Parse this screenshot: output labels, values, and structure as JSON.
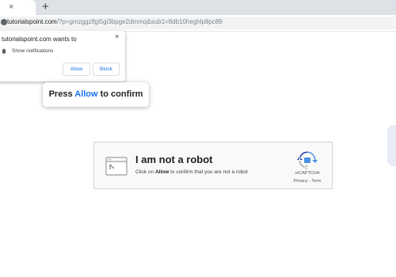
{
  "browser": {
    "new_tab_symbol": "+",
    "tab_close_symbol": "×",
    "url_host": "tutorialspoint.com",
    "url_path": "/?p=gmzggzlfgi5gi3bpge2dmmq&sub1=8db10heghlp8pc89"
  },
  "notification_prompt": {
    "title": "tutorialspoint.com wants to",
    "close_symbol": "×",
    "permission_label": "Show notifications",
    "allow_label": "Allow",
    "block_label": "Block"
  },
  "callout": {
    "prefix": "Press ",
    "highlight": "Allow",
    "suffix": " to confirm",
    "highlight_color": "#1a73e8"
  },
  "captcha": {
    "title": "I am not a robot",
    "sub_prefix": "Click on ",
    "sub_bold": "Allow",
    "sub_suffix": " to confirm that you are not a robot",
    "brand": "reCAPTCHA",
    "links": "Privacy - Term"
  },
  "icons": {
    "site": "site-info-icon",
    "bell": "bell-icon",
    "window": "browser-window-icon",
    "logo": "recaptcha-logo-icon"
  }
}
